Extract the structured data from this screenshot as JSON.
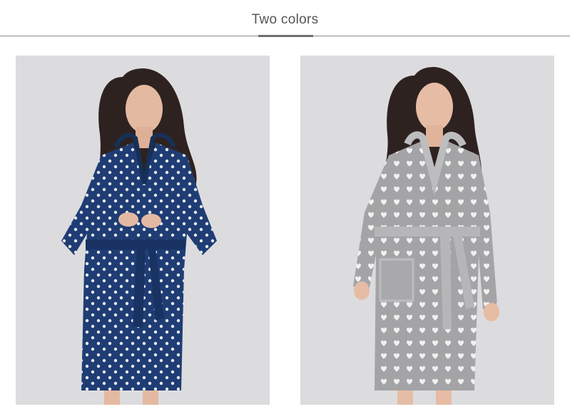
{
  "header": {
    "title": "Two colors"
  },
  "products": [
    {
      "variant": "navy blue polka-dot hooded robe",
      "color": "#1f3d74",
      "dot_shape": "dot"
    },
    {
      "variant": "gray heart-print hooded robe",
      "color": "#a4a4a6",
      "dot_shape": "heart"
    }
  ],
  "colors": {
    "background": "#ffffff",
    "title_text": "#555555",
    "divider": "#8c8c8c",
    "photo_backdrop": "#dcdcde"
  }
}
